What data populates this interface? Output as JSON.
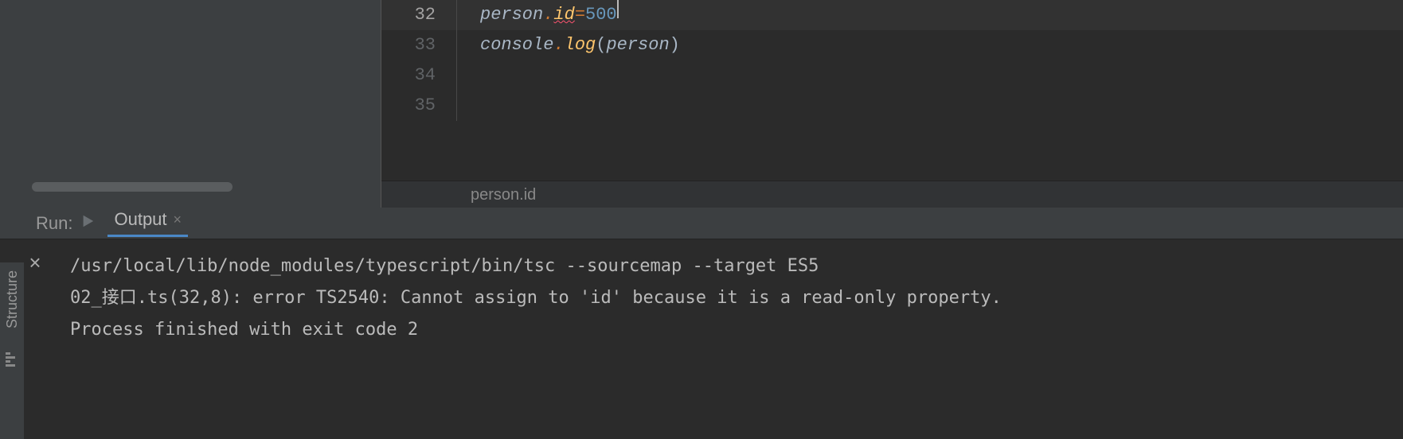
{
  "editor": {
    "lines": [
      {
        "num": "32",
        "tokens": [
          "person",
          ".",
          "id",
          " = ",
          "500"
        ],
        "active": true
      },
      {
        "num": "33",
        "tokens": [
          "console",
          ".",
          "log",
          "(",
          "person",
          ")"
        ],
        "active": false
      },
      {
        "num": "34",
        "tokens": [],
        "active": false
      },
      {
        "num": "35",
        "tokens": [],
        "active": false
      }
    ],
    "breadcrumb": "person.id"
  },
  "panel": {
    "run_label": "Run:",
    "tab_label": "Output",
    "output_lines": [
      "/usr/local/lib/node_modules/typescript/bin/tsc --sourcemap --target ES5",
      "02_接口.ts(32,8): error TS2540: Cannot assign to 'id' because it is a read-only property.",
      "",
      "Process finished with exit code 2"
    ]
  },
  "tool_windows": {
    "structure": "Structure"
  }
}
